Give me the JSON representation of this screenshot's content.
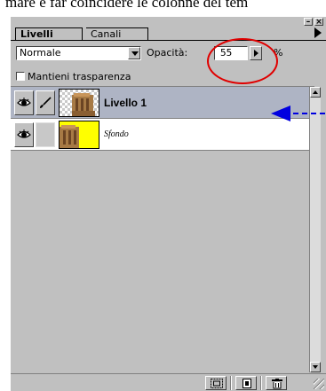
{
  "caption": "mare e far coincidere le colonne del tem",
  "panel": {
    "window_buttons": {
      "minimize": "–",
      "close": "×"
    },
    "tabs": [
      {
        "label": "Livelli",
        "active": true
      },
      {
        "label": "Canali",
        "active": false
      }
    ],
    "blend_mode": "Normale",
    "opacity_label": "Opacità:",
    "opacity_value": "55",
    "opacity_unit": "%",
    "preserve_transparency_label": "Mantieni trasparenza",
    "preserve_transparency_checked": false,
    "layers": [
      {
        "name": "Livello 1",
        "visible": true,
        "brush": true,
        "selected": true
      },
      {
        "name": "Sfondo",
        "visible": true,
        "brush": false,
        "selected": false
      }
    ],
    "bottom_icons": [
      "mask-icon",
      "new-layer-icon",
      "trash-icon"
    ]
  },
  "colors": {
    "panel_bg": "#c0c0c0",
    "selected_row": "#aeb4c4",
    "annotation_ellipse": "#e00000",
    "annotation_arrow": "#0000e0",
    "thumb_yellow": "#ffff00"
  }
}
